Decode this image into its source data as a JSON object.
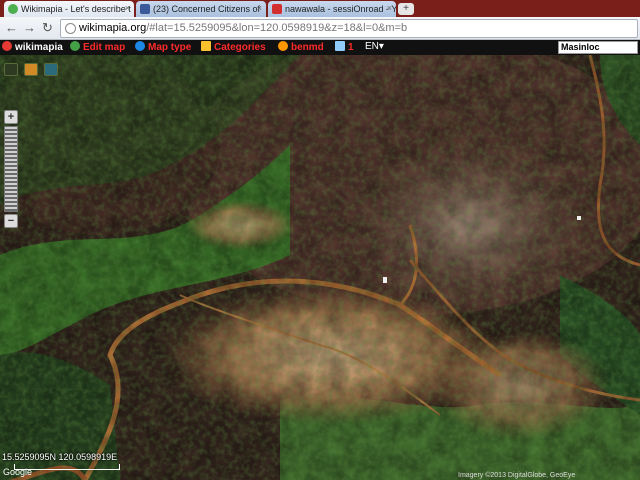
{
  "browser": {
    "tabs": [
      {
        "label": "Wikimapia - Let's describe t",
        "active": true,
        "favicon_color": "#4caf50"
      },
      {
        "label": "(23) Concerned Citizens of",
        "active": false,
        "favicon_color": "#3b5998"
      },
      {
        "label": "nawawala - sessiOnroad - Y",
        "active": false,
        "favicon_color": "#d32f2f"
      }
    ],
    "new_tab_label": "+",
    "url_domain": "wikimapia.org",
    "url_rest": "/#lat=15.5259095&lon=120.0598919&z=18&l=0&m=b"
  },
  "wikimapia": {
    "logo": "wikimapia",
    "edit_map": "Edit map",
    "map_type": "Map type",
    "categories": "Categories",
    "user": "benmd",
    "messages_count": "1",
    "language": "EN",
    "search_value": "Masinloc"
  },
  "map": {
    "coordinates": "15.5259095N 120.0598919E",
    "logo": "Google",
    "attribution": "Imagery ©2013 DigitalGlobe, GeoEye",
    "zoom_in": "+",
    "zoom_out": "−"
  },
  "colors": {
    "tabstrip": "#7a1f1a",
    "menu_red": "#ff2b2b",
    "terrain_dark": "#3b2a22",
    "vegetation": "#3f7a2c",
    "road": "#c47a3c"
  }
}
